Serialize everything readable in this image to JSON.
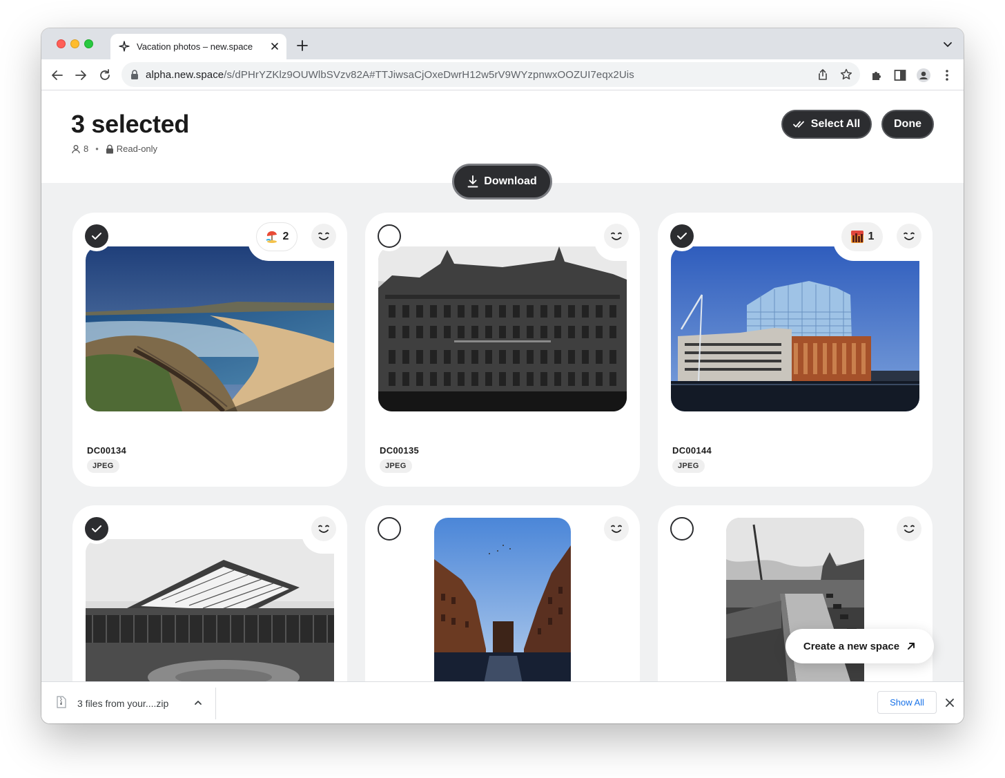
{
  "browser": {
    "tab_title": "Vacation photos – new.space",
    "url_host": "alpha.new.space",
    "url_path": "/s/dPHrYZKlz9OUWlbSVzv82A#TTJiwsaCjOxeDwrH12w5rV9WYzpnwxOOZUI7eqx2Uis"
  },
  "header": {
    "title": "3 selected",
    "members_count": "8",
    "access": "Read-only",
    "select_all_label": "Select All",
    "done_label": "Done",
    "download_label": "Download"
  },
  "cards": [
    {
      "name": "DC00134",
      "type": "JPEG",
      "selected": true,
      "reaction_count": "2",
      "reaction_icon": "beach-umbrella-icon"
    },
    {
      "name": "DC00135",
      "type": "JPEG",
      "selected": false
    },
    {
      "name": "DC00144",
      "type": "JPEG",
      "selected": true,
      "reaction_count": "1",
      "reaction_icon": "city-sunset-icon"
    },
    {
      "selected": true
    },
    {
      "selected": false
    },
    {
      "selected": false
    }
  ],
  "fab": {
    "label": "Create a new space"
  },
  "download_shelf": {
    "file_label": "3 files from your....zip",
    "show_all_label": "Show All"
  },
  "colors": {
    "accent_dark": "#2c2d30",
    "page_bg": "#f0f1f2",
    "link_blue": "#1a73e8"
  }
}
